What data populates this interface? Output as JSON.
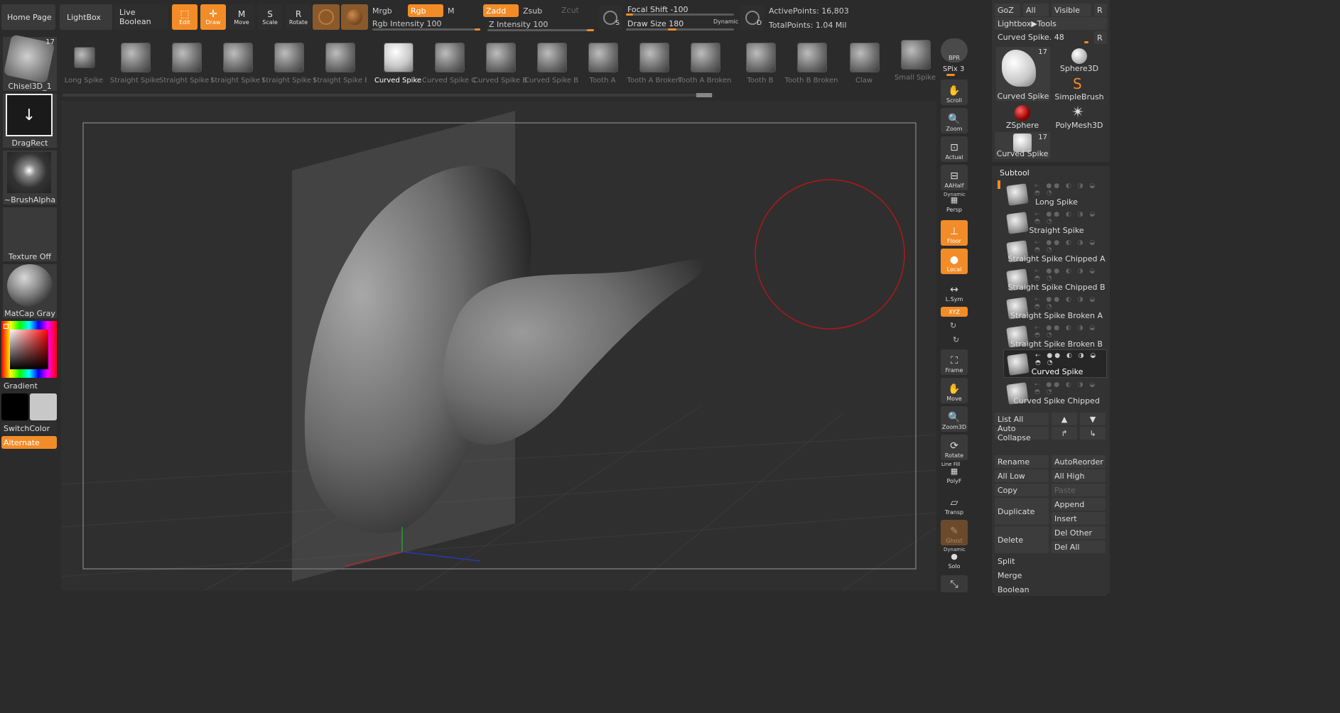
{
  "topbar": {
    "home": "Home Page",
    "lightbox": "LightBox",
    "liveboolean": "Live Boolean",
    "edit": "Edit",
    "draw": "Draw",
    "move": "Move",
    "scale": "Scale",
    "rotate": "Rotate",
    "mrgb": "Mrgb",
    "rgb": "Rgb",
    "m": "M",
    "rgb_intensity": "Rgb Intensity 100",
    "zadd": "Zadd",
    "zsub": "Zsub",
    "zcut": "Zcut",
    "z_intensity": "Z Intensity 100",
    "focal_shift": "Focal Shift -100",
    "draw_size": "Draw Size 180",
    "dynamic": "Dynamic",
    "active_points": "ActivePoints: 16,803",
    "total_points": "TotalPoints: 1.04 Mil",
    "s_label": "S",
    "d_label": "D"
  },
  "tool_shelf": [
    {
      "label": "Long Spike"
    },
    {
      "label": "Straight Spike"
    },
    {
      "label": "Straight Spike C"
    },
    {
      "label": "Straight Spike C"
    },
    {
      "label": "Straight Spike E"
    },
    {
      "label": "Straight Spike E"
    },
    {
      "label": "Curved Spike",
      "active": true
    },
    {
      "label": "Curved Spike Cl"
    },
    {
      "label": "Curved Spike Br"
    },
    {
      "label": "Curved Spike Br"
    },
    {
      "label": "Tooth A"
    },
    {
      "label": "Tooth A Broken"
    },
    {
      "label": "Tooth A Broken"
    },
    {
      "label": "Tooth B"
    },
    {
      "label": "Tooth B Broken"
    },
    {
      "label": "Claw"
    },
    {
      "label": "Small Spike"
    }
  ],
  "left": {
    "brush": "Chisel3D_1",
    "brush_count": "17",
    "stroke": "DragRect",
    "alpha": "~BrushAlpha",
    "texture": "Texture Off",
    "material": "MatCap Gray",
    "gradient": "Gradient",
    "switchcolor": "SwitchColor",
    "alternate": "Alternate"
  },
  "right_toolbar": {
    "bpr": "BPR",
    "spix": "SPix 3",
    "scroll": "Scroll",
    "zoom": "Zoom",
    "actual": "Actual",
    "aahalf": "AAHalf",
    "dynamic": "Dynamic",
    "persp": "Persp",
    "floor": "Floor",
    "local": "Local",
    "lsym": "L.Sym",
    "xyz": "XYZ",
    "frame": "Frame",
    "move": "Move",
    "zoom3d": "Zoom3D",
    "rotate": "Rotate",
    "linefill": "Line Fill",
    "polyf": "PolyF",
    "transp": "Transp",
    "ghost": "Ghost",
    "solo": "Solo"
  },
  "tool_palette": {
    "goz": "GoZ",
    "all": "All",
    "visible": "Visible",
    "r": "R",
    "lightbox_tools": "Lightbox▶Tools",
    "current": "Curved Spike. 48",
    "count": "17",
    "items": [
      "Curved Spike",
      "Sphere3D",
      "SimpleBrush",
      "ZSphere",
      "PolyMesh3D",
      "Curved Spike"
    ]
  },
  "subtool": {
    "title": "Subtool",
    "items": [
      "Long Spike",
      "Straight Spike",
      "Straight Spike Chipped A",
      "Straight Spike Chipped B",
      "Straight Spike Broken A",
      "Straight Spike Broken B",
      "Curved Spike",
      "Curved Spike Chipped"
    ],
    "list_all": "List All",
    "auto_collapse": "Auto Collapse",
    "rename": "Rename",
    "autoreorder": "AutoReorder",
    "all_low": "All Low",
    "all_high": "All High",
    "copy": "Copy",
    "paste": "Paste",
    "duplicate": "Duplicate",
    "append": "Append",
    "insert": "Insert",
    "delete": "Delete",
    "del_other": "Del Other",
    "del_all": "Del All",
    "split": "Split",
    "merge": "Merge",
    "boolean": "Boolean"
  }
}
